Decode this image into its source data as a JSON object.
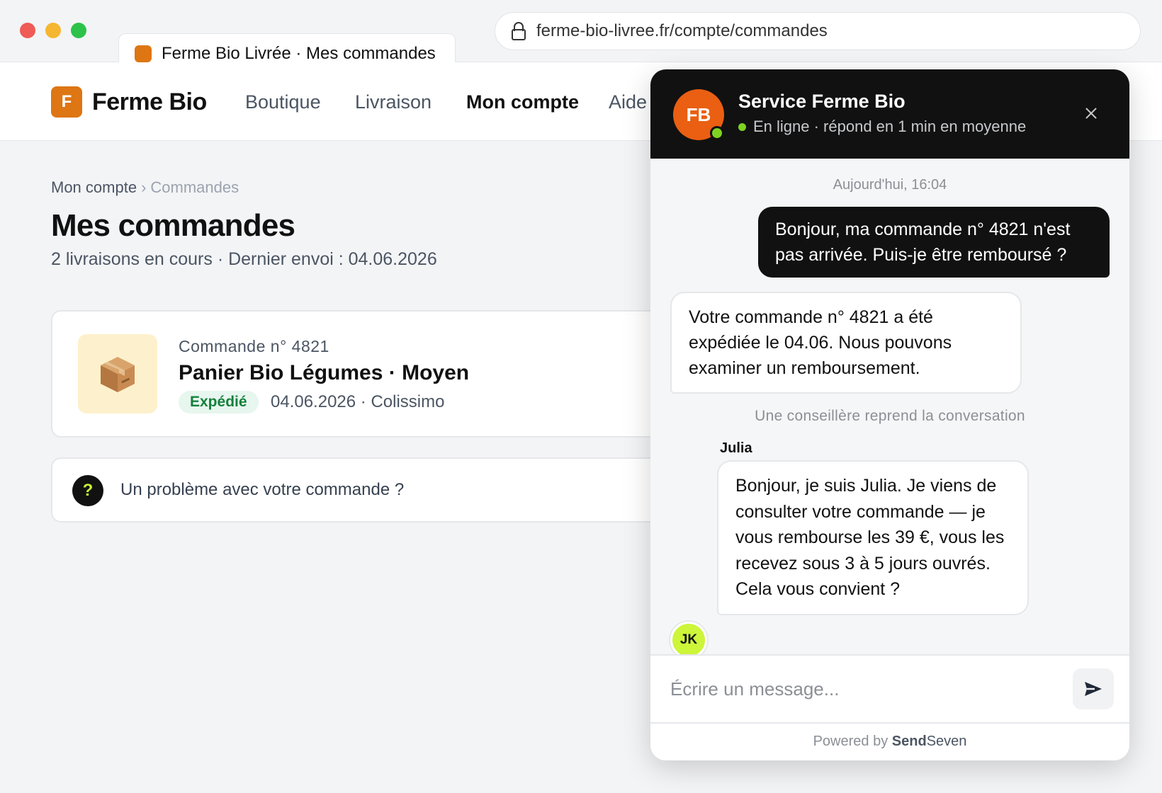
{
  "browser": {
    "tab_title": "Ferme Bio Livrée · Mes commandes",
    "url": "ferme-bio-livree.fr/compte/commandes"
  },
  "site": {
    "logo_letter": "F",
    "logo_text": "Ferme Bio",
    "nav": [
      "Boutique",
      "Livraison",
      "Mon compte",
      "Aide"
    ],
    "active_nav": "Mon compte",
    "accent_color": "#dd7613"
  },
  "page": {
    "breadcrumb": [
      "Mon compte",
      "Commandes"
    ],
    "breadcrumb_sep": "›",
    "title": "Mes commandes",
    "subtitle": "2 livraisons en cours · Dernier envoi : 04.06.2026"
  },
  "order": {
    "number": "Commande n° 4821",
    "name": "Panier Bio Légumes · Moyen",
    "status": "Expédié",
    "meta": "04.06.2026 · Colissimo",
    "icon": "package-icon"
  },
  "help": {
    "icon": "?",
    "text": "Un problème avec votre commande ?"
  },
  "chat": {
    "avatar": "FB",
    "title": "Service Ferme Bio",
    "status": "En ligne · répond en 1 min en moyenne",
    "timestamp": "Aujourd'hui, 16:04",
    "user_message": "Bonjour, ma commande n° 4821 n'est pas arrivée. Puis-je être remboursé ?",
    "bot_message": "Votre commande n° 4821 a été expédiée le 04.06. Nous pouvons examiner un remboursement.",
    "handoff": "Une conseillère reprend la conversation",
    "agent_name": "Julia",
    "agent_initials": "JK",
    "agent_message": "Bonjour, je suis Julia. Je viens de consulter votre commande — je vous rembourse les 39 €, vous les recevez sous 3 à 5 jours ouvrés. Cela vous convient ?",
    "input_placeholder": "Écrire un message...",
    "powered_by": "Powered by",
    "brand_bold": "Send",
    "brand_rest": "Seven"
  }
}
